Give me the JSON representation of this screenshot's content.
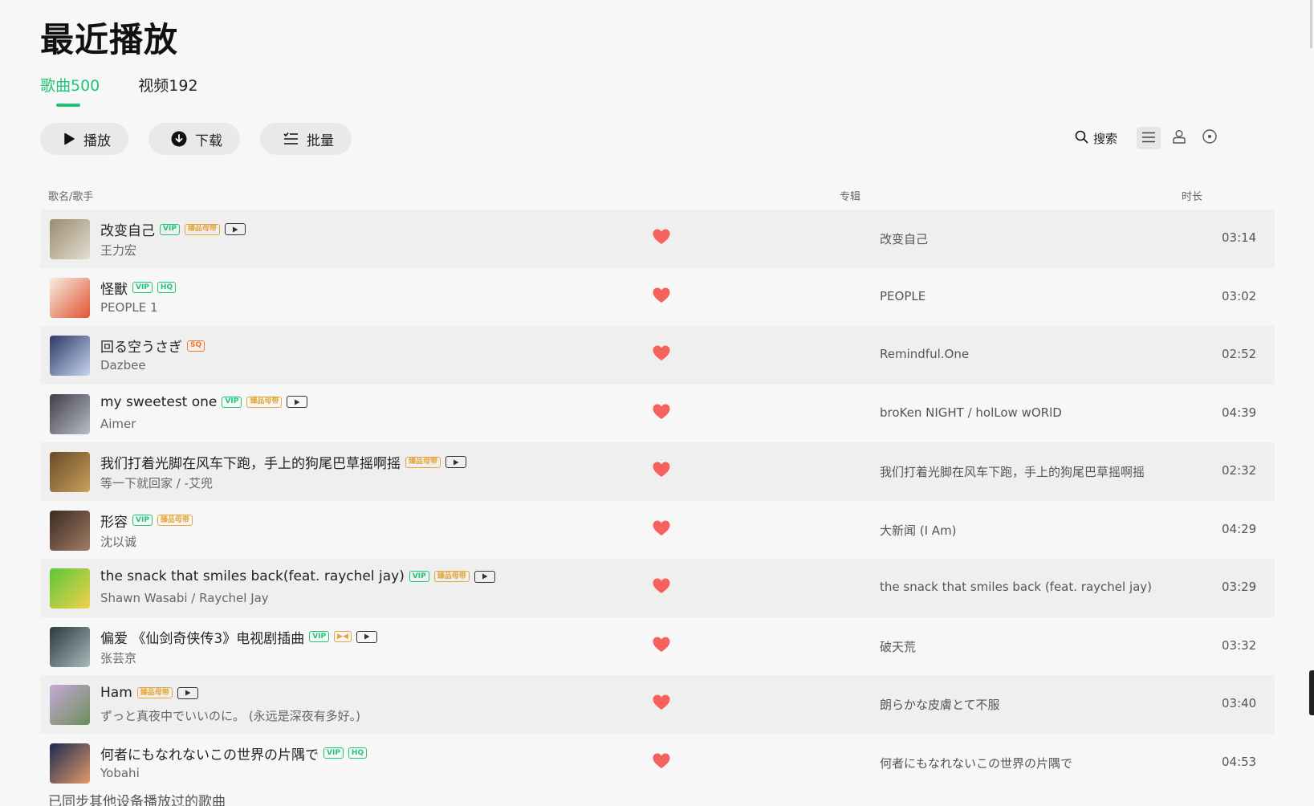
{
  "title": "最近播放",
  "tabs": [
    {
      "label": "歌曲500",
      "active": true
    },
    {
      "label": "视频192",
      "active": false
    }
  ],
  "actions": {
    "play": "播放",
    "download": "下载",
    "batch": "批量"
  },
  "tools": {
    "search": "搜索"
  },
  "columns": {
    "song": "歌名/歌手",
    "album": "专辑",
    "duration": "时长"
  },
  "songs": [
    {
      "title": "改变自己",
      "artist": "王力宏",
      "album": "改变自己",
      "duration": "03:14",
      "badges": [
        "VIP",
        "臻品母带"
      ],
      "mv": true,
      "cover": [
        "#9a8b70",
        "#e3ddd0"
      ]
    },
    {
      "title": "怪獸",
      "artist": "PEOPLE 1",
      "album": "PEOPLE",
      "duration": "03:02",
      "badges": [
        "VIP",
        "HQ"
      ],
      "mv": false,
      "cover": [
        "#f5eee4",
        "#e3542f"
      ]
    },
    {
      "title": "回る空うさぎ",
      "artist": "Dazbee",
      "album": "Remindful.One",
      "duration": "02:52",
      "badges": [
        "SQ"
      ],
      "mv": false,
      "cover": [
        "#2c3a66",
        "#c7d4ef"
      ]
    },
    {
      "title": "my sweetest one",
      "artist": "Aimer",
      "album": "broKen NIGHT / holLow wORlD",
      "duration": "04:39",
      "badges": [
        "VIP",
        "臻品母带"
      ],
      "mv": true,
      "cover": [
        "#3f3f47",
        "#b9bcc6"
      ]
    },
    {
      "title": "我们打着光脚在风车下跑，手上的狗尾巴草摇啊摇",
      "artist": "等一下就回家 / -艾兜",
      "album": "我们打着光脚在风车下跑，手上的狗尾巴草摇啊摇",
      "duration": "02:32",
      "badges": [
        "臻品母带"
      ],
      "mv": true,
      "cover": [
        "#6a4a2a",
        "#c9a05a"
      ]
    },
    {
      "title": "形容",
      "artist": "沈以诚",
      "album": "大新闻 (I Am)",
      "duration": "04:29",
      "badges": [
        "VIP",
        "臻品母带"
      ],
      "mv": false,
      "cover": [
        "#3a2a22",
        "#a27d66"
      ]
    },
    {
      "title": "the snack that smiles back(feat. raychel jay)",
      "artist": "Shawn Wasabi / Raychel Jay",
      "album": "the snack that smiles back (feat. raychel jay)",
      "duration": "03:29",
      "badges": [
        "VIP",
        "臻品母带"
      ],
      "mv": true,
      "cover": [
        "#5bc63c",
        "#f2d14a"
      ]
    },
    {
      "title": "偏爱 《仙剑奇侠传3》电视剧插曲",
      "artist": "张芸京",
      "album": "破天荒",
      "duration": "03:32",
      "badges": [
        "VIP",
        "dolby"
      ],
      "mv": true,
      "cover": [
        "#2c3a3f",
        "#a9b8bb"
      ]
    },
    {
      "title": "Ham",
      "artist": "ずっと真夜中でいいのに。 (永远是深夜有多好。)",
      "album": "朗らかな皮膚とて不服",
      "duration": "03:40",
      "badges": [
        "臻品母带"
      ],
      "mv": true,
      "cover": [
        "#c8a8d8",
        "#6b8f5a"
      ]
    },
    {
      "title": "何者にもなれないこの世界の片隅で",
      "artist": "Yobahi",
      "album": "何者にもなれないこの世界の片隅で",
      "duration": "04:53",
      "badges": [
        "VIP",
        "HQ"
      ],
      "mv": false,
      "cover": [
        "#1d2a52",
        "#e09a6a"
      ]
    }
  ],
  "footer": "已同步其他设备播放过的歌曲",
  "colors": {
    "accent": "#1ec773",
    "heart": "#f5625d",
    "vip": "#1ec773",
    "gold": "#e4a63a",
    "sq": "#f27a30"
  }
}
